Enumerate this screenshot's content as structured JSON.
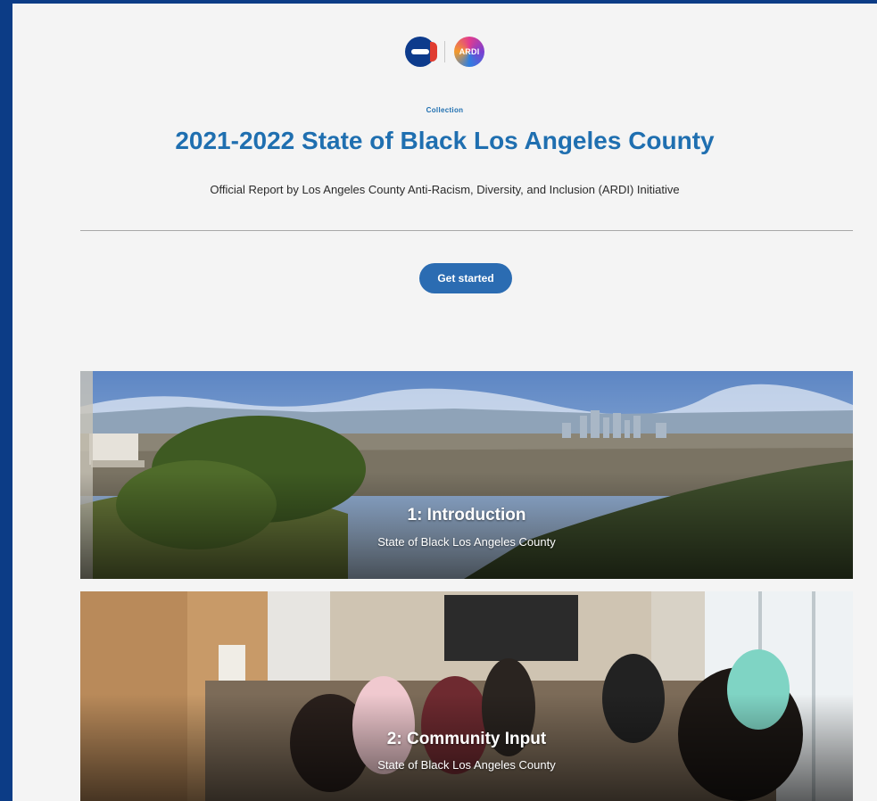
{
  "header": {
    "logos": [
      {
        "icon": "equity-e-logo",
        "colors": [
          "#0d3b8c",
          "#e03c31"
        ]
      },
      {
        "icon": "ardi-logo",
        "text": "ARDI"
      }
    ],
    "eyebrow": "Collection",
    "title": "2021-2022 State of Black Los Angeles County",
    "subtitle": "Official Report by Los Angeles County Anti-Racism, Diversity, and Inclusion (ARDI) Initiative"
  },
  "cta": {
    "label": "Get started",
    "color": "#2b6cb2"
  },
  "cards": [
    {
      "title": "1: Introduction",
      "subtitle": "State of Black Los Angeles County",
      "image": "los-angeles-skyline-photo"
    },
    {
      "title": "2: Community Input",
      "subtitle": "State of Black Los Angeles County",
      "image": "meeting-room-photo"
    }
  ],
  "colors": {
    "accent": "#1f6fb0",
    "page_background": "#f4f4f4",
    "outer_frame": "#0c3c86"
  }
}
